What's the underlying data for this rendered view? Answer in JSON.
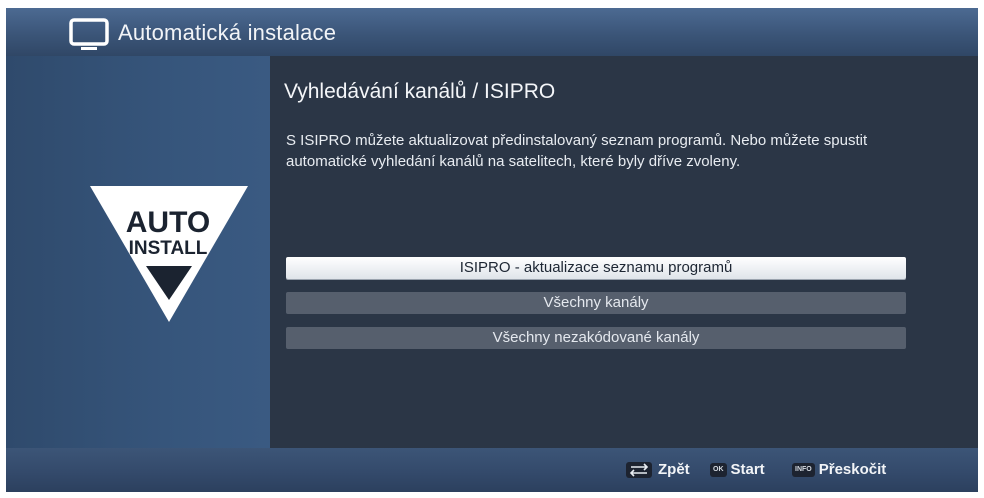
{
  "header": {
    "title": "Automatická instalace",
    "icon": "tv-icon"
  },
  "logo": {
    "line1": "AUTO",
    "line2": "INSTALL"
  },
  "main": {
    "heading": "Vyhledávání kanálů / ISIPRO",
    "description": "S ISIPRO můžete aktualizovat předinstalovaný seznam programů. Nebo můžete spustit automatické vyhledání kanálů na satelitech, které byly dříve zvoleny.",
    "options": [
      {
        "label": "ISIPRO - aktualizace seznamu programů",
        "selected": true
      },
      {
        "label": "Všechny kanály",
        "selected": false
      },
      {
        "label": "Všechny nezakódované kanály",
        "selected": false
      }
    ]
  },
  "footer": {
    "back_label": "Zpět",
    "start_key": "OK",
    "start_label": "Start",
    "skip_key": "INFO",
    "skip_label": "Přeskočit"
  },
  "colors": {
    "background": "#2b3646",
    "titlebar": "#3b5578",
    "selected_option": "#ffffff",
    "option": "#565f6d"
  }
}
